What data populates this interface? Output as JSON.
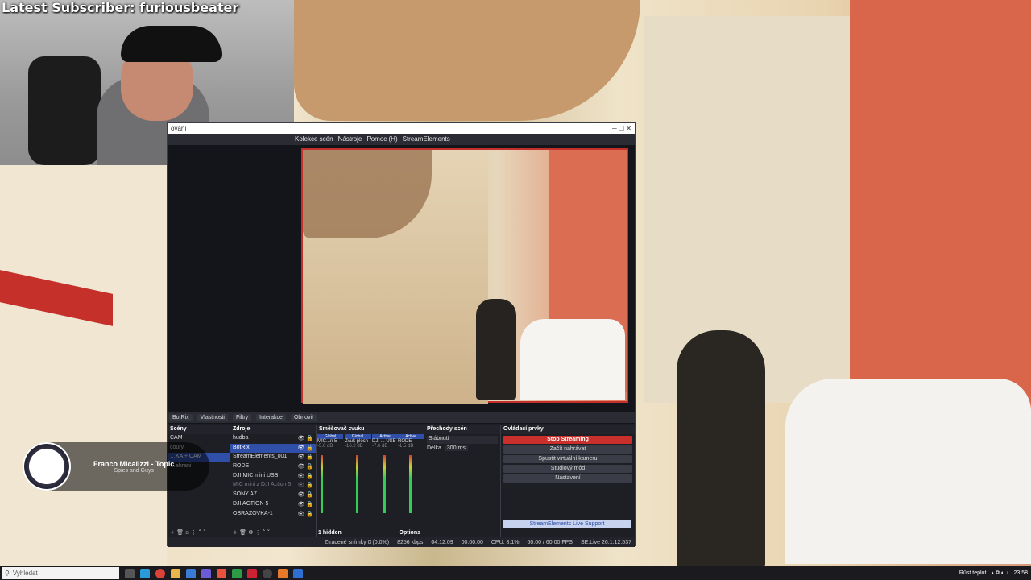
{
  "overlay": {
    "latest_subscriber": "Latest Subscriber: furiousbeater"
  },
  "now_playing": {
    "title": "Franco Micalizzi - Topic",
    "subtitle": "Spies and Guys"
  },
  "obs": {
    "menu": [
      "Kolekce scén",
      "Nástroje",
      "Pomoc (H)",
      "StreamElements"
    ],
    "window_title": "ování",
    "toolbar": {
      "selected_source": "BotRix",
      "properties": "Vlastnosti",
      "filters": "Filtry",
      "interaction": "Interakce",
      "refresh": "Obnovit"
    },
    "scenes": {
      "title": "Scény",
      "items": [
        "CAM",
        "coury",
        "…KA + CAM",
        "…ehrani"
      ]
    },
    "sources": {
      "title": "Zdroje",
      "items": [
        "hudba",
        "BotRix",
        "StreamElements_001",
        "RODE",
        "DJI MIC mini USB",
        "MIC mini z DJI Action 5",
        "SONY A7",
        "DJI ACTION 5",
        "OBRAZOVKA-1"
      ]
    },
    "mixer": {
      "title": "Směšovač zvuku",
      "channels": [
        {
          "tag": "Global",
          "name": "MIC...n 5",
          "db": "-5.0 dB"
        },
        {
          "tag": "Global",
          "name": "Zvuk ploch",
          "db": "-16.2 dB"
        },
        {
          "tag": "Active",
          "name": "DJI ... USB",
          "db": "-7.6 dB"
        },
        {
          "tag": "Active",
          "name": "RODE",
          "db": "-1.5 dB"
        }
      ],
      "hidden": "1 hidden",
      "options": "Options"
    },
    "transitions": {
      "title": "Přechody scén",
      "type": "Slábnutí",
      "duration_label": "Délka",
      "duration_value": "300 ms"
    },
    "controls": {
      "title": "Ovládací prvky",
      "stop_streaming": "Stop Streaming",
      "start_recording": "Začít nahrávat",
      "virtual_camera": "Spustit virtuální kameru",
      "studio_mode": "Studiový mód",
      "settings": "Nastavení",
      "se_support": "StreamElements Live Support"
    },
    "status": {
      "dropped": "Ztracené snímky 0 (0.0%)",
      "bitrate": "8256 kbps",
      "live_time": "04:12:09",
      "rec_time": "00:00:00",
      "cpu": "CPU: 8.1%",
      "fps": "60.00 / 60.00 FPS",
      "version": "SE.Live 26.1.12.537"
    }
  },
  "taskbar": {
    "search_placeholder": "Vyhledat",
    "weather": "Růst teplot",
    "clock": "23:58"
  }
}
